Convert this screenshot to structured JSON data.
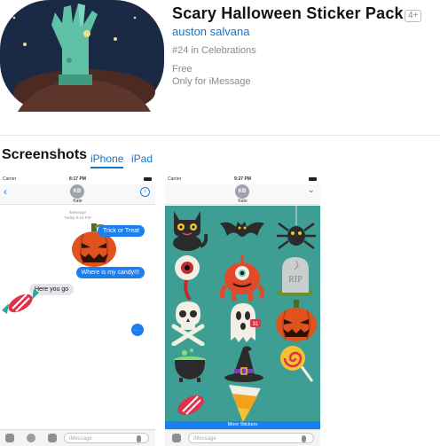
{
  "app": {
    "title": "Scary Halloween Sticker Pack",
    "age_rating": "4+",
    "developer": "auston salvana",
    "rank": "#24 in Celebrations",
    "price": "Free",
    "availability": "Only for iMessage"
  },
  "screenshots": {
    "title": "Screenshots",
    "tabs": [
      {
        "label": "iPhone",
        "active": true
      },
      {
        "label": "iPad",
        "active": false
      }
    ]
  },
  "phone1": {
    "carrier": "Carrier",
    "time": "8:17 PM",
    "avatar_initials": "KB",
    "contact": "Kate",
    "date_line1": "iMessage",
    "date_line2": "Today 8:16 PM",
    "messages": [
      {
        "text": "Trick or Treat",
        "from": "me"
      },
      {
        "text": "Where is my candy!!!",
        "from": "me"
      },
      {
        "text": "Here you go",
        "from": "them"
      },
      {
        "text": "...",
        "from": "me"
      }
    ],
    "input_placeholder": "iMessage"
  },
  "phone2": {
    "carrier": "Carrier",
    "time": "9:27 PM",
    "avatar_initials": "KB",
    "contact": "Kate",
    "more_stickers": "More Stickers",
    "input_placeholder": "iMessage",
    "sticker_icons": [
      "black-cat",
      "bat",
      "spider",
      "eyeball",
      "one-eyed-monster",
      "tombstone-rip",
      "skull-crossbones",
      "ghost",
      "pumpkin",
      "cauldron",
      "witch-hat",
      "lollipop",
      "candy-wrapper",
      "candy-corn"
    ],
    "tombstone_text": "RIP",
    "ghost_badge": "31"
  },
  "colors": {
    "accent": "#1572c9",
    "imessage_blue": "#1a7ff0",
    "sticker_bg": "#3e9e93",
    "icon_bg": "#1b2a44",
    "pumpkin": "#e0531f"
  }
}
